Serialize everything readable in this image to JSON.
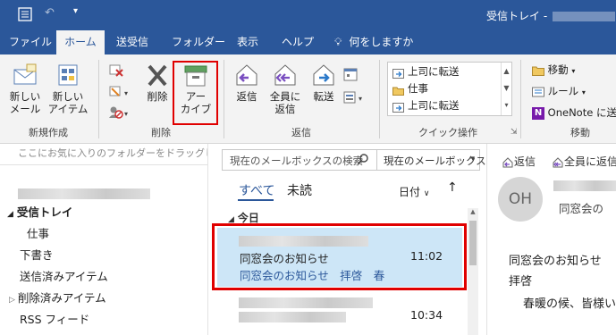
{
  "titlebar": {
    "title": "受信トレイ - "
  },
  "tabs": [
    "ファイル",
    "ホーム",
    "送受信",
    "フォルダー",
    "表示",
    "ヘルプ",
    "何をしますか"
  ],
  "ribbon": {
    "new_email": "新しい\nメール",
    "new_item": "新しい\nアイテム",
    "new_group": "新規作成",
    "delete": "削除",
    "archive": "アー\nカイブ",
    "delete_group": "削除",
    "reply": "返信",
    "reply_all": "全員に\n返信",
    "forward": "転送",
    "respond_group": "返信",
    "quick_steps": [
      "上司に転送",
      "仕事",
      "上司に転送"
    ],
    "quick_group": "クイック操作",
    "move": "移動",
    "rules": "ルール",
    "onenote": "OneNote に送",
    "move_group": "移動"
  },
  "folders": {
    "fav_hint": "ここにお気に入りのフォルダーをドラッグします",
    "inbox": "受信トレイ",
    "work": "仕事",
    "drafts": "下書き",
    "sent": "送信済みアイテム",
    "deleted": "削除済みアイテム",
    "rss": "RSS フィード"
  },
  "list": {
    "search_placeholder": "現在のメールボックスの検索",
    "search_scope": "現在のメールボックス",
    "filter_all": "すべて",
    "filter_unread": "未読",
    "sort_label": "日付",
    "today_header": "今日",
    "messages": [
      {
        "subject": "同窓会のお知らせ",
        "preview": "同窓会のお知らせ　拝啓　春",
        "time": "11:02"
      },
      {
        "subject": "",
        "preview": "",
        "time": "10:34"
      }
    ]
  },
  "reading": {
    "reply": "返信",
    "reply_all": "全員に返信",
    "avatar_initials": "OH",
    "to_line": "同窓会の",
    "subject": "同窓会のお知らせ",
    "greeting": "拝啓",
    "body_line": "春暖の候、皆様い"
  },
  "colors": {
    "accent": "#2b579a",
    "highlight": "#e00000",
    "selected": "#cde6f7"
  }
}
